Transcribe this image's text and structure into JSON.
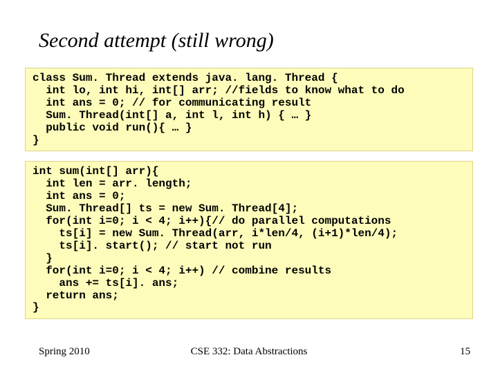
{
  "title": "Second attempt (still wrong)",
  "code1": "class Sum. Thread extends java. lang. Thread {\n  int lo, int hi, int[] arr; //fields to know what to do\n  int ans = 0; // for communicating result\n  Sum. Thread(int[] a, int l, int h) { … }\n  public void run(){ … }\n}",
  "code2": "int sum(int[] arr){\n  int len = arr. length;\n  int ans = 0;\n  Sum. Thread[] ts = new Sum. Thread[4];\n  for(int i=0; i < 4; i++){// do parallel computations\n    ts[i] = new Sum. Thread(arr, i*len/4, (i+1)*len/4);\n    ts[i]. start(); // start not run\n  }\n  for(int i=0; i < 4; i++) // combine results\n    ans += ts[i]. ans;\n  return ans;\n}",
  "footer": {
    "left": "Spring 2010",
    "center": "CSE 332: Data Abstractions",
    "right": "15"
  }
}
